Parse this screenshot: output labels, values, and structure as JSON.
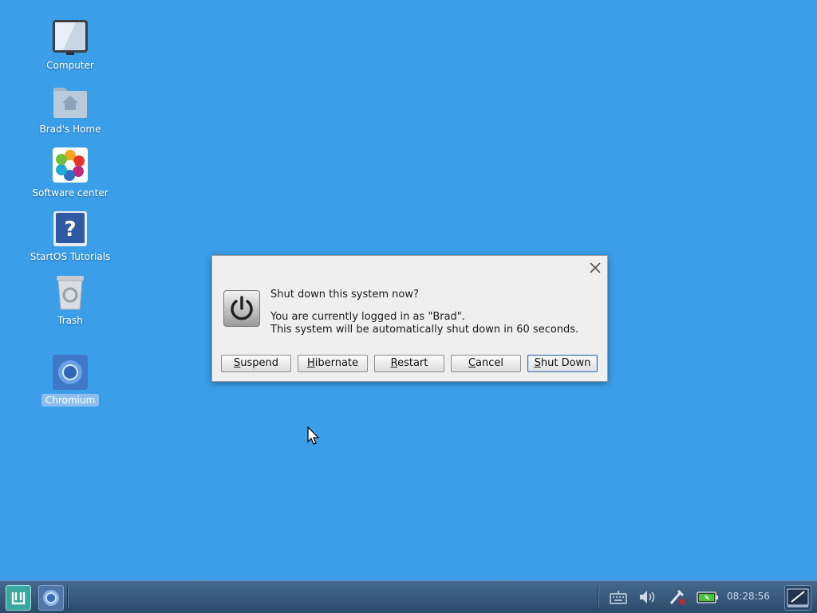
{
  "desktop": {
    "icons": [
      {
        "label": "Computer",
        "icon": "computer-icon"
      },
      {
        "label": "Brad's Home",
        "icon": "home-folder-icon"
      },
      {
        "label": "Software center",
        "icon": "software-center-icon"
      },
      {
        "label": "StartOS Tutorials",
        "icon": "help-icon"
      },
      {
        "label": "Trash",
        "icon": "trash-icon"
      },
      {
        "label": "Chromium",
        "icon": "chromium-icon",
        "selected": true
      }
    ],
    "background_color": "#3a9ee8"
  },
  "dialog": {
    "heading": "Shut down this system now?",
    "message_line1": "You are currently logged in as \"Brad\".",
    "message_line2": "This system will be automatically shut down in 60 seconds.",
    "buttons": {
      "suspend_mnemonic": "S",
      "suspend_rest": "uspend",
      "hibernate_mnemonic": "H",
      "hibernate_rest": "ibernate",
      "restart_mnemonic": "R",
      "restart_rest": "estart",
      "cancel_mnemonic": "C",
      "cancel_rest": "ancel",
      "shutdown_mnemonic": "S",
      "shutdown_rest": "hut Down"
    }
  },
  "taskbar": {
    "clock": "08:28:56",
    "tray_icons": [
      "keyboard-icon",
      "volume-icon",
      "network-disconnected-icon",
      "battery-icon",
      "show-desktop-icon"
    ]
  }
}
